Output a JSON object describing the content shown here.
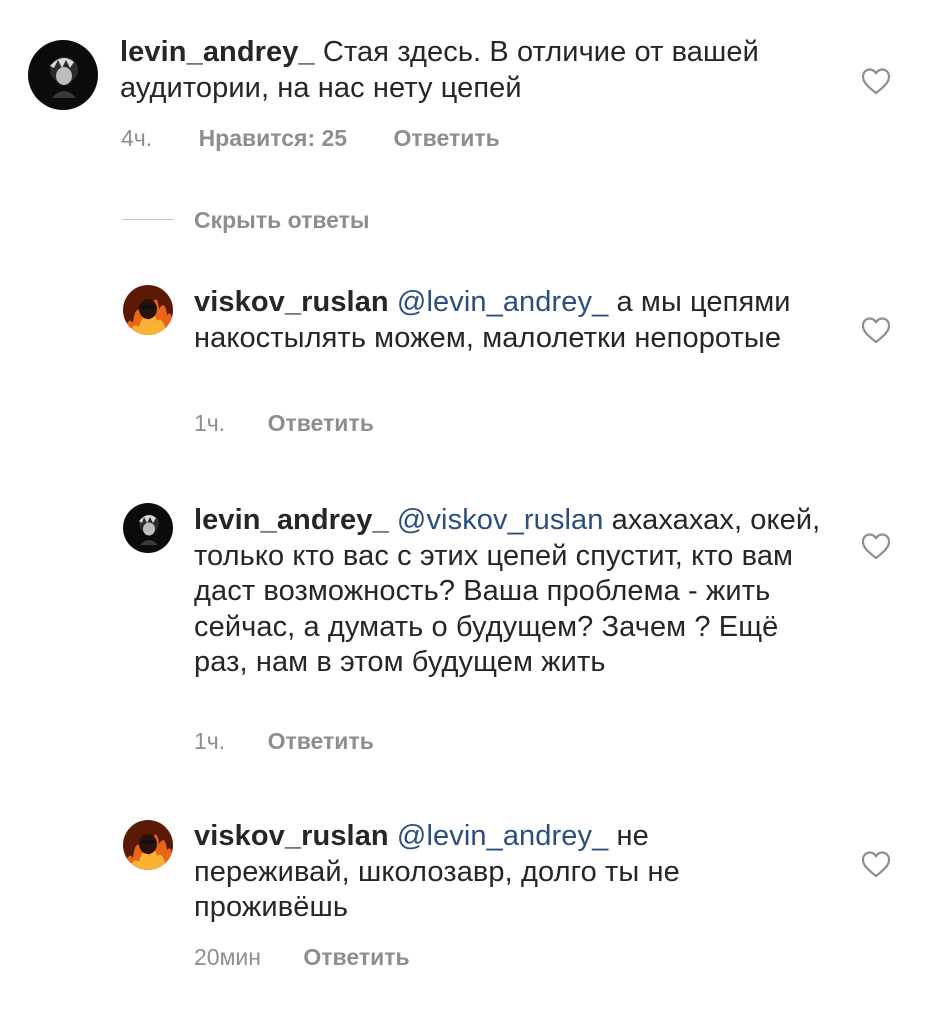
{
  "comments": [
    {
      "username": "levin_andrey_",
      "mention": "",
      "text": "Стая здесь. В отличие от вашей аудитории, на нас нету цепей",
      "time": "4ч.",
      "likes": "Нравится: 25",
      "reply": "Ответить",
      "avatar": "dark-anime-avatar"
    },
    {
      "username": "viskov_ruslan",
      "mention": "@levin_andrey_",
      "text": "а мы цепями накостылять можем, малолетки непоротые",
      "time": "1ч.",
      "reply": "Ответить",
      "avatar": "fire-avatar"
    },
    {
      "username": "levin_andrey_",
      "mention": "@viskov_ruslan",
      "text": "ахахахах, окей, только кто вас с этих цепей спустит, кто вам даст возможность? Ваша проблема - жить сейчас, а думать о будущем? Зачем ? Ещё раз, нам в этом будущем жить",
      "time": "1ч.",
      "reply": "Ответить",
      "avatar": "dark-anime-avatar"
    },
    {
      "username": "viskov_ruslan",
      "mention": "@levin_andrey_",
      "text": "не переживай, школозавр, долго ты не проживёшь",
      "time": "20мин",
      "reply": "Ответить",
      "avatar": "fire-avatar"
    }
  ],
  "hide_replies_label": "Скрыть ответы",
  "colors": {
    "text": "#262626",
    "meta": "#8e8e8e",
    "mention": "#2a4f7f",
    "divider": "#c7c7c7"
  }
}
